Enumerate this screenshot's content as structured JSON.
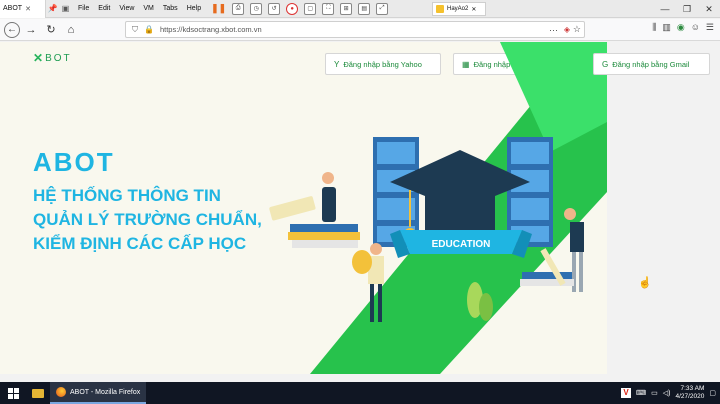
{
  "browser": {
    "tab_title": "ABOT",
    "menu": [
      "File",
      "Edit",
      "View",
      "VM",
      "Tabs",
      "Help"
    ],
    "second_tab": "HayAo2",
    "url": "https://kdsoctrang.xbot.com.vn"
  },
  "page": {
    "logo": "BOT",
    "login_buttons": {
      "yahoo": "Đăng nhập bằng Yahoo",
      "microsoft": "Đăng nhập bằng Microsoft",
      "gmail": "Đăng nhập bằng Gmail"
    },
    "hero_title": "ABOT",
    "hero_subtitle_lines": [
      "HỆ THỐNG THÔNG TIN",
      "QUẢN LÝ TRƯỜNG CHUẨN,",
      "KIỂM ĐỊNH CÁC CẤP HỌC"
    ],
    "banner_text": "EDUCATION"
  },
  "taskbar": {
    "app_label": "ABOT - Mozilla Firefox",
    "time": "7:33 AM",
    "date": "4/27/2020"
  },
  "colors": {
    "accent_blue": "#1fb5e2",
    "accent_green": "#27c24c",
    "login_text": "#1b8a3a"
  }
}
